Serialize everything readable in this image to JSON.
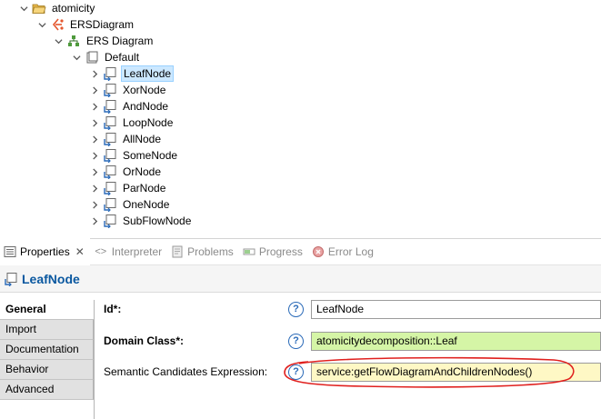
{
  "tree": {
    "root": {
      "label": "atomicity",
      "icon": "folder-open-icon"
    },
    "level1": {
      "label": "ERSDiagram",
      "icon": "ers-diagram-icon"
    },
    "level2": {
      "label": "ERS Diagram",
      "icon": "diagram-hierarchy-icon"
    },
    "level3": {
      "label": "Default",
      "icon": "layer-icon"
    },
    "nodes": [
      "LeafNode",
      "XorNode",
      "AndNode",
      "LoopNode",
      "AllNode",
      "SomeNode",
      "OrNode",
      "ParNode",
      "OneNode",
      "SubFlowNode"
    ],
    "selected": "LeafNode"
  },
  "tabs": [
    {
      "label": "Properties",
      "icon": "properties-icon",
      "active": true,
      "close": "✕"
    },
    {
      "label": "Interpreter",
      "icon": "interpreter-icon",
      "active": false,
      "prefix": "<>"
    },
    {
      "label": "Problems",
      "icon": "problems-icon",
      "active": false
    },
    {
      "label": "Progress",
      "icon": "progress-icon",
      "active": false
    },
    {
      "label": "Error Log",
      "icon": "error-log-icon",
      "active": false
    }
  ],
  "panel_title": "LeafNode",
  "side_tabs": [
    {
      "label": "General",
      "active": true
    },
    {
      "label": "Import",
      "active": false
    },
    {
      "label": "Documentation",
      "active": false
    },
    {
      "label": "Behavior",
      "active": false
    },
    {
      "label": "Advanced",
      "active": false
    }
  ],
  "fields": {
    "id": {
      "label": "Id*:",
      "value": "LeafNode",
      "help": "?"
    },
    "domain_class": {
      "label": "Domain Class*:",
      "value": "atomicitydecomposition::Leaf",
      "help": "?"
    },
    "semantic": {
      "label": "Semantic Candidates Expression:",
      "value": "service:getFlowDiagramAndChildrenNodes()",
      "help": "?"
    }
  },
  "colors": {
    "selection": "#cce8ff",
    "title_blue": "#0a58a0",
    "green_field": "#d5f5a6",
    "yellow_field": "#fef8c5",
    "annotation": "#e0201e"
  }
}
